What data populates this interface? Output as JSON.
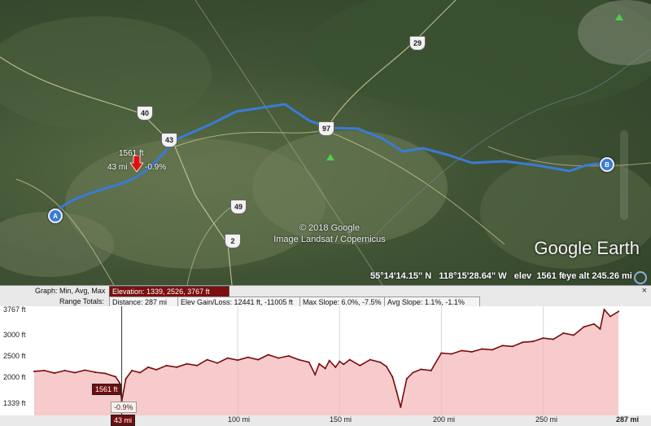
{
  "map": {
    "shields": [
      "40",
      "43",
      "29",
      "97",
      "49",
      "2"
    ],
    "start_pin": "A",
    "end_pin": "B",
    "cursor": {
      "elev_label": "1561 ft",
      "dist_label": "43 mi",
      "slope_label": "-0.9%"
    },
    "copyright_line1": "© 2018 Google",
    "copyright_line2": "Image Landsat / Copernicus",
    "logo": "Google Earth",
    "status": {
      "lat": "55°14'14.15\" N",
      "lon": "118°15'28.64\" W",
      "elev_label": "elev",
      "elev": "1561 ft",
      "eye_alt_label": "eye alt",
      "eye_alt": "245.26 mi"
    },
    "colors": {
      "route": "#3a7bd5",
      "profile_line": "#7a0a0a",
      "profile_fill": "#f3b5b5"
    }
  },
  "profile": {
    "graph_label": "Graph: Min, Avg, Max",
    "elevation_stats": "Elevation: 1339, 2526, 3767 ft",
    "range_label": "Range Totals:",
    "distance": "Distance: 287 mi",
    "gain_loss": "Elev Gain/Loss: 12441 ft, -11005 ft",
    "max_slope": "Max Slope: 6.0%, -7.5%",
    "avg_slope": "Avg Slope: 1.1%, -1.1%",
    "close_label": "×",
    "cursor_elev": "1561 ft",
    "cursor_slope": "-0.9%",
    "cursor_dist": "43 mi"
  },
  "chart_data": {
    "type": "area",
    "x_unit": "mi",
    "y_unit": "ft",
    "xlim": [
      0,
      287
    ],
    "ylim": [
      1339,
      3767
    ],
    "y_ticks": [
      "3767 ft",
      "3000 ft",
      "2500 ft",
      "2000 ft",
      "1339 ft"
    ],
    "x_ticks": [
      "43 mi",
      "100 mi",
      "150 mi",
      "200 mi",
      "250 mi",
      "287 mi"
    ],
    "x": [
      0,
      5,
      10,
      15,
      20,
      25,
      30,
      35,
      40,
      42,
      43,
      45,
      48,
      52,
      56,
      60,
      65,
      70,
      75,
      80,
      85,
      90,
      95,
      100,
      105,
      110,
      115,
      120,
      125,
      130,
      135,
      138,
      140,
      143,
      145,
      148,
      150,
      152,
      155,
      160,
      165,
      170,
      173,
      176,
      178,
      180,
      183,
      186,
      190,
      195,
      200,
      205,
      210,
      215,
      220,
      225,
      230,
      235,
      240,
      245,
      250,
      255,
      260,
      265,
      270,
      275,
      278,
      280,
      283,
      287
    ],
    "values": [
      2280,
      2300,
      2240,
      2300,
      2250,
      2310,
      2260,
      2230,
      2150,
      2000,
      1561,
      2100,
      2300,
      2250,
      2380,
      2320,
      2420,
      2380,
      2460,
      2420,
      2560,
      2480,
      2600,
      2550,
      2620,
      2560,
      2680,
      2600,
      2650,
      2560,
      2500,
      2200,
      2460,
      2350,
      2540,
      2380,
      2520,
      2450,
      2560,
      2420,
      2560,
      2500,
      2400,
      2150,
      1800,
      1420,
      2100,
      2250,
      2330,
      2300,
      2720,
      2700,
      2780,
      2750,
      2820,
      2800,
      2900,
      2880,
      2980,
      3000,
      3080,
      3050,
      3200,
      3150,
      3350,
      3420,
      3300,
      3767,
      3600,
      3720
    ]
  }
}
